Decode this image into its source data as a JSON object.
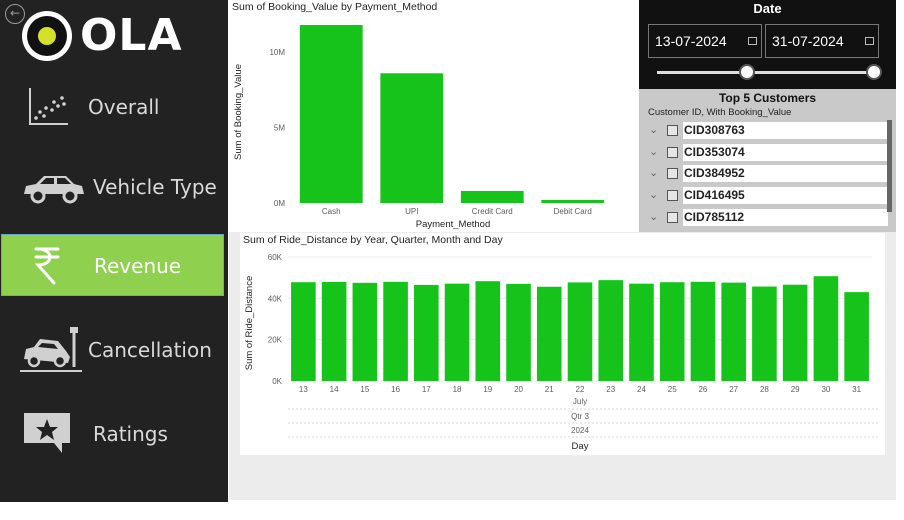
{
  "app": {
    "back_icon": "back-arrow-icon",
    "logo_text": "OLA"
  },
  "nav": [
    {
      "id": "overall",
      "label": "Overall",
      "icon": "scatter-chart-icon",
      "active": false
    },
    {
      "id": "vehicle-type",
      "label": "Vehicle Type",
      "icon": "car-icon",
      "active": false
    },
    {
      "id": "revenue",
      "label": "Revenue",
      "icon": "rupee-icon",
      "active": true
    },
    {
      "id": "cancellation",
      "label": "Cancellation",
      "icon": "car-crash-icon",
      "active": false
    },
    {
      "id": "ratings",
      "label": "Ratings",
      "icon": "star-speech-bubble-icon",
      "active": false
    }
  ],
  "date_filter": {
    "title": "Date",
    "start": "13-07-2024",
    "end": "31-07-2024",
    "range_fraction": [
      0.42,
      1.0
    ]
  },
  "top_customers": {
    "title": "Top 5 Customers",
    "subtitle": "Customer ID, With Booking_Value",
    "items": [
      "CID308763",
      "CID353074",
      "CID384952",
      "CID416495",
      "CID785112"
    ]
  },
  "colors": {
    "bar": "#15c31a",
    "sidebar": "#222222",
    "active": "#8fd14f"
  },
  "chart_data": [
    {
      "type": "bar",
      "title": "Sum of Booking_Value by Payment_Method",
      "xlabel": "Payment_Method",
      "ylabel": "Sum of Booking_Value",
      "categories": [
        "Cash",
        "UPI",
        "Credit Card",
        "Debit Card"
      ],
      "values": [
        11800000,
        8600000,
        800000,
        200000
      ],
      "ylim": [
        0,
        12000000
      ],
      "yticks": [
        0,
        5000000,
        10000000
      ],
      "ytick_labels": [
        "0M",
        "5M",
        "10M"
      ]
    },
    {
      "type": "bar",
      "title": "Sum of Ride_Distance by Year, Quarter, Month and Day",
      "xlabel": "Day",
      "ylabel": "Sum of Ride_Distance",
      "categories": [
        "13",
        "14",
        "15",
        "16",
        "17",
        "18",
        "19",
        "20",
        "21",
        "22",
        "23",
        "24",
        "25",
        "26",
        "27",
        "28",
        "29",
        "30",
        "31"
      ],
      "values": [
        47800,
        47900,
        47500,
        48000,
        46500,
        47100,
        48300,
        47000,
        45600,
        47700,
        48800,
        47100,
        47800,
        48000,
        47600,
        45700,
        46600,
        50700,
        43000
      ],
      "hierarchy_labels": {
        "month": "July",
        "quarter": "Qtr 3",
        "year": "2024"
      },
      "ylim": [
        0,
        60000
      ],
      "yticks": [
        0,
        20000,
        40000,
        60000
      ],
      "ytick_labels": [
        "0K",
        "20K",
        "40K",
        "60K"
      ]
    }
  ]
}
